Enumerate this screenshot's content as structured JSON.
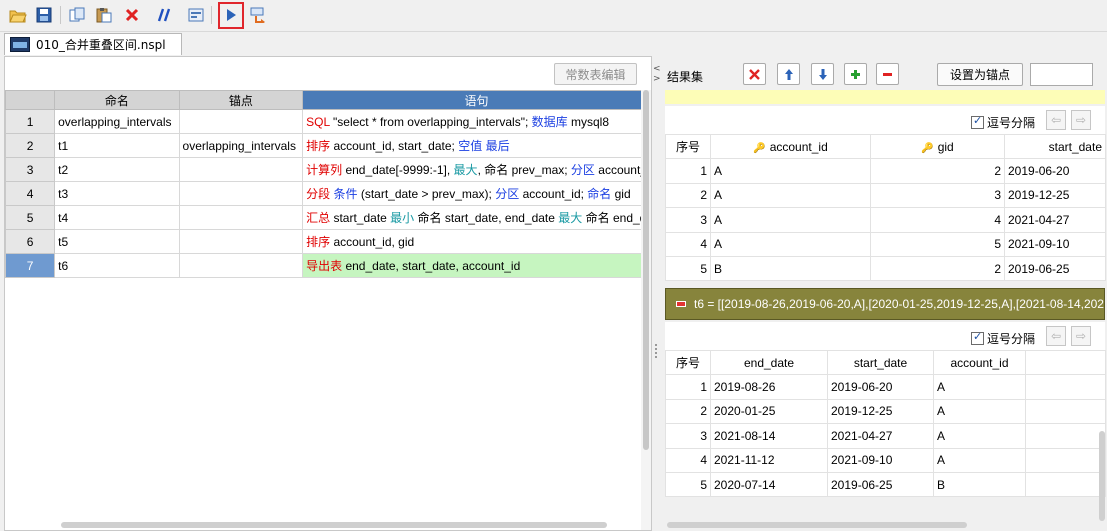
{
  "toolbar": {
    "icons": [
      "open-folder-icon",
      "save-icon",
      "copy-icon",
      "paste-icon",
      "delete-icon",
      "comment-icon",
      "screen-icon",
      "run-icon",
      "step-icon"
    ]
  },
  "file_tab": {
    "label": "010_合并重叠区间.nspl"
  },
  "left": {
    "const_button": "常数表编辑",
    "columns": [
      "命名",
      "锚点",
      "语句"
    ],
    "rows": [
      {
        "num": "1",
        "name": "overlapping_intervals",
        "anchor": "",
        "stmt": [
          {
            "t": "SQL",
            "c": "r"
          },
          {
            "t": " \"select * from overlapping_intervals\"; ",
            "c": ""
          },
          {
            "t": "数据库",
            "c": "b"
          },
          {
            "t": " mysql8",
            "c": ""
          }
        ]
      },
      {
        "num": "2",
        "name": "t1",
        "anchor": "overlapping_intervals",
        "stmt": [
          {
            "t": "排序",
            "c": "r"
          },
          {
            "t": " account_id, start_date; ",
            "c": ""
          },
          {
            "t": "空值",
            "c": "b"
          },
          {
            "t": " ",
            "c": ""
          },
          {
            "t": "最后",
            "c": "b"
          }
        ]
      },
      {
        "num": "3",
        "name": "t2",
        "anchor": "",
        "stmt": [
          {
            "t": "计算列",
            "c": "r"
          },
          {
            "t": " end_date[-9999:-1], ",
            "c": ""
          },
          {
            "t": "最大",
            "c": "t"
          },
          {
            "t": ", 命名 prev_max; ",
            "c": ""
          },
          {
            "t": "分区",
            "c": "b"
          },
          {
            "t": " account_",
            "c": ""
          }
        ]
      },
      {
        "num": "4",
        "name": "t3",
        "anchor": "",
        "stmt": [
          {
            "t": "分段",
            "c": "r"
          },
          {
            "t": " ",
            "c": ""
          },
          {
            "t": "条件",
            "c": "b"
          },
          {
            "t": " (start_date > prev_max); ",
            "c": ""
          },
          {
            "t": "分区",
            "c": "b"
          },
          {
            "t": " account_id; ",
            "c": ""
          },
          {
            "t": "命名",
            "c": "b"
          },
          {
            "t": " gid",
            "c": ""
          }
        ]
      },
      {
        "num": "5",
        "name": "t4",
        "anchor": "",
        "stmt": [
          {
            "t": "汇总",
            "c": "r"
          },
          {
            "t": " start_date ",
            "c": ""
          },
          {
            "t": "最小",
            "c": "t"
          },
          {
            "t": " 命名 start_date, end_date ",
            "c": ""
          },
          {
            "t": "最大",
            "c": "t"
          },
          {
            "t": " 命名 end_d",
            "c": ""
          }
        ]
      },
      {
        "num": "6",
        "name": "t5",
        "anchor": "",
        "stmt": [
          {
            "t": "排序",
            "c": "r"
          },
          {
            "t": " account_id, gid",
            "c": ""
          }
        ]
      },
      {
        "num": "7",
        "name": "t6",
        "anchor": "",
        "stmt": [
          {
            "t": "导出表",
            "c": "r"
          },
          {
            "t": " end_date, start_date, account_id",
            "c": ""
          }
        ]
      }
    ]
  },
  "right": {
    "result_label": "结果集",
    "anchor_button": "设置为锚点",
    "comma_label": "逗号分隔",
    "table1": {
      "headers": [
        "序号",
        "account_id",
        "gid",
        "start_date"
      ],
      "rows": [
        [
          "1",
          "A",
          "2",
          "2019-06-20"
        ],
        [
          "2",
          "A",
          "3",
          "2019-12-25"
        ],
        [
          "3",
          "A",
          "4",
          "2021-04-27"
        ],
        [
          "4",
          "A",
          "5",
          "2021-09-10"
        ],
        [
          "5",
          "B",
          "2",
          "2019-06-25"
        ]
      ]
    },
    "t6_bar": "t6 = [[2019-08-26,2019-06-20,A],[2020-01-25,2019-12-25,A],[2021-08-14,202",
    "table2": {
      "headers": [
        "序号",
        "end_date",
        "start_date",
        "account_id"
      ],
      "rows": [
        [
          "1",
          "2019-08-26",
          "2019-06-20",
          "A"
        ],
        [
          "2",
          "2020-01-25",
          "2019-12-25",
          "A"
        ],
        [
          "3",
          "2021-08-14",
          "2021-04-27",
          "A"
        ],
        [
          "4",
          "2021-11-12",
          "2021-09-10",
          "A"
        ],
        [
          "5",
          "2020-07-14",
          "2019-06-25",
          "B"
        ]
      ]
    },
    "colors": {
      "stmt_header": "#4a7bb7",
      "selected_row": "#6f9ad0",
      "export_row": "#c6f5c0",
      "t6_bar": "#87843c",
      "run_highlight": "#e0262c"
    }
  }
}
